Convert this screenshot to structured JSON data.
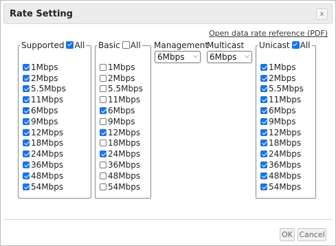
{
  "dialog": {
    "title": "Rate Setting",
    "close_label": "x"
  },
  "reference_link": "Open data rate reference (PDF)",
  "columns": {
    "supported": {
      "label": "Supported",
      "all_label": "All",
      "all_checked": true,
      "rates": [
        {
          "label": "1Mbps",
          "checked": true
        },
        {
          "label": "2Mbps",
          "checked": true
        },
        {
          "label": "5.5Mbps",
          "checked": true
        },
        {
          "label": "11Mbps",
          "checked": true
        },
        {
          "label": "6Mbps",
          "checked": true
        },
        {
          "label": "9Mbps",
          "checked": true
        },
        {
          "label": "12Mbps",
          "checked": true
        },
        {
          "label": "18Mbps",
          "checked": true
        },
        {
          "label": "24Mbps",
          "checked": true
        },
        {
          "label": "36Mbps",
          "checked": true
        },
        {
          "label": "48Mbps",
          "checked": true
        },
        {
          "label": "54Mbps",
          "checked": true
        }
      ]
    },
    "basic": {
      "label": "Basic",
      "all_label": "All",
      "all_checked": false,
      "rates": [
        {
          "label": "1Mbps",
          "checked": false
        },
        {
          "label": "2Mbps",
          "checked": false
        },
        {
          "label": "5.5Mbps",
          "checked": false
        },
        {
          "label": "11Mbps",
          "checked": false
        },
        {
          "label": "6Mbps",
          "checked": true
        },
        {
          "label": "9Mbps",
          "checked": false
        },
        {
          "label": "12Mbps",
          "checked": true
        },
        {
          "label": "18Mbps",
          "checked": false
        },
        {
          "label": "24Mbps",
          "checked": true
        },
        {
          "label": "36Mbps",
          "checked": false
        },
        {
          "label": "48Mbps",
          "checked": false
        },
        {
          "label": "54Mbps",
          "checked": false
        }
      ]
    },
    "unicast": {
      "label": "Unicast",
      "all_label": "All",
      "all_checked": true,
      "rates": [
        {
          "label": "1Mbps",
          "checked": true
        },
        {
          "label": "2Mbps",
          "checked": true
        },
        {
          "label": "5.5Mbps",
          "checked": true
        },
        {
          "label": "11Mbps",
          "checked": true
        },
        {
          "label": "6Mbps",
          "checked": true
        },
        {
          "label": "9Mbps",
          "checked": true
        },
        {
          "label": "12Mbps",
          "checked": true
        },
        {
          "label": "18Mbps",
          "checked": true
        },
        {
          "label": "24Mbps",
          "checked": true
        },
        {
          "label": "36Mbps",
          "checked": true
        },
        {
          "label": "48Mbps",
          "checked": true
        },
        {
          "label": "54Mbps",
          "checked": true
        }
      ]
    }
  },
  "management": {
    "label": "Management",
    "value": "6Mbps"
  },
  "multicast": {
    "label": "Multicast",
    "value": "6Mbps"
  },
  "footer": {
    "ok_label": "OK",
    "cancel_label": "Cancel"
  },
  "colors": {
    "accent": "#1a73e8",
    "title_bar": "#ececec",
    "border": "#8a8a8a"
  },
  "icons": {
    "checked": "checkbox-checked-icon",
    "unchecked": "checkbox-unchecked-icon",
    "dropdown": "chevron-down-icon",
    "close": "close-icon"
  }
}
